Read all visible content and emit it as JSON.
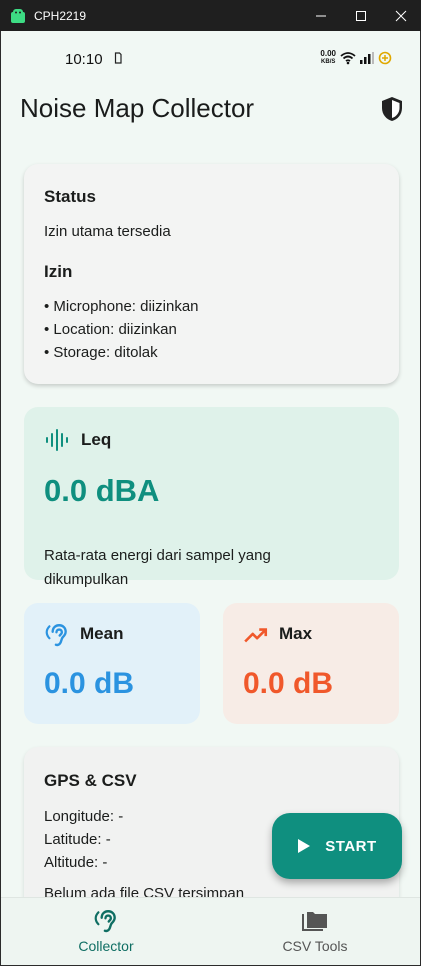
{
  "window": {
    "title": "CPH2219"
  },
  "status_bar": {
    "time": "10:10",
    "net_speed": "0.00",
    "net_unit": "KB/S"
  },
  "app": {
    "title": "Noise Map Collector"
  },
  "status_card": {
    "title": "Status",
    "message": "Izin utama tersedia",
    "permissions_title": "Izin",
    "permissions": [
      "• Microphone: diizinkan",
      "• Location: diizinkan",
      "• Storage: ditolak"
    ]
  },
  "leq_card": {
    "title": "Leq",
    "value": "0.0 dBA",
    "description_line1": "Rata-rata energi dari sampel yang",
    "description_line2": "dikumpulkan"
  },
  "mean_card": {
    "title": "Mean",
    "value": "0.0 dB",
    "color": "#2b93e0"
  },
  "max_card": {
    "title": "Max",
    "value": "0.0 dB",
    "color": "#f0582b"
  },
  "gps_card": {
    "title": "GPS & CSV",
    "longitude": "Longitude: -",
    "latitude": "Latitude: -",
    "altitude": "Altitude: -",
    "csv_status": "Belum ada file CSV tersimpan"
  },
  "fab": {
    "label": "START"
  },
  "bottom_nav": {
    "items": [
      {
        "label": "Collector",
        "selected": true
      },
      {
        "label": "CSV Tools",
        "selected": false
      }
    ]
  },
  "colors": {
    "primary": "#0f8f7f",
    "background": "#f1f8f4"
  }
}
